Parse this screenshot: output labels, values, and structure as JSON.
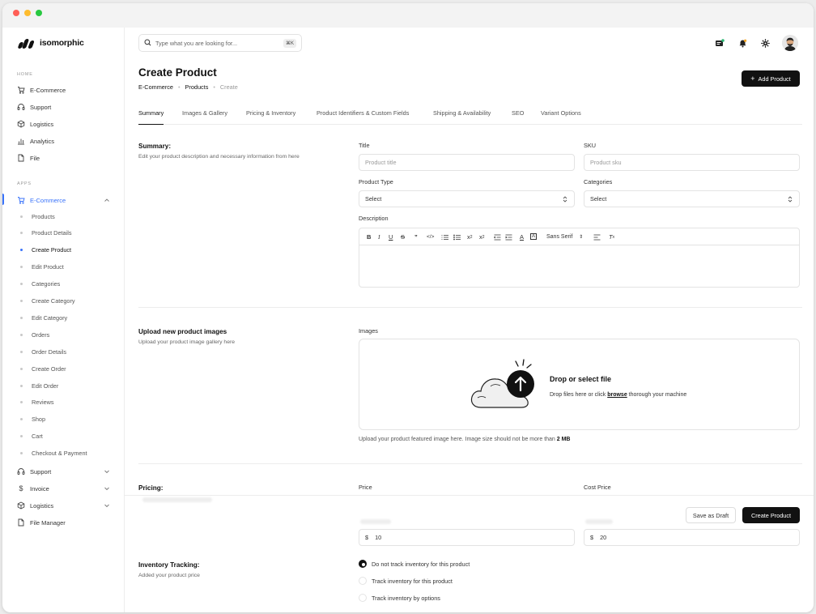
{
  "app": {
    "name": "isomorphic"
  },
  "sidebar": {
    "home_label": "HOME",
    "home_items": [
      {
        "label": "E-Commerce",
        "icon": "cart-icon"
      },
      {
        "label": "Support",
        "icon": "headset-icon"
      },
      {
        "label": "Logistics",
        "icon": "package-icon"
      },
      {
        "label": "Analytics",
        "icon": "chart-icon"
      },
      {
        "label": "File",
        "icon": "file-icon"
      }
    ],
    "apps_label": "APPS",
    "apps_active": {
      "label": "E-Commerce",
      "icon": "cart-icon"
    },
    "ecommerce_sub": [
      "Products",
      "Product Details",
      "Create Product",
      "Edit Product",
      "Categories",
      "Create Category",
      "Edit Category",
      "Orders",
      "Order Details",
      "Create Order",
      "Edit Order",
      "Reviews",
      "Shop",
      "Cart",
      "Checkout & Payment"
    ],
    "apps_items": [
      {
        "label": "Support",
        "icon": "headset-icon"
      },
      {
        "label": "Invoice",
        "icon": "dollar-icon"
      },
      {
        "label": "Logistics",
        "icon": "package-icon"
      },
      {
        "label": "File Manager",
        "icon": "file-icon"
      }
    ]
  },
  "topbar": {
    "search_placeholder": "Type what you are looking for...",
    "shortcut": "⌘K"
  },
  "page": {
    "title": "Create Product",
    "breadcrumb": [
      "E-Commerce",
      "Products",
      "Create"
    ],
    "add_button": "Add Product"
  },
  "tabs": [
    "Summary",
    "Images & Gallery",
    "Pricing & Inventory",
    "Product Identifiers & Custom Fields",
    "Shipping & Availability",
    "SEO",
    "Variant Options"
  ],
  "summary": {
    "title": "Summary:",
    "desc": "Edit your product description and necessary information from here",
    "title_label": "Title",
    "title_placeholder": "Product title",
    "sku_label": "SKU",
    "sku_placeholder": "Product sku",
    "type_label": "Product Type",
    "type_value": "Select",
    "categories_label": "Categories",
    "categories_value": "Select",
    "description_label": "Description",
    "font_select": "Sans Serif"
  },
  "images": {
    "title": "Upload new product images",
    "desc": "Upload your product image gallery here",
    "label": "Images",
    "drop_title": "Drop or select file",
    "drop_text_before": "Drop files here or click",
    "drop_link": "browse",
    "drop_text_after": "thorough your machine",
    "help_text": "Upload your product featured image here. Image size should not be more than",
    "help_size": "2 MB"
  },
  "pricing": {
    "title": "Pricing:",
    "price_label": "Price",
    "cost_label": "Cost Price",
    "currency": "$",
    "value1": "10",
    "value2": "20"
  },
  "inventory": {
    "title": "Inventory Tracking:",
    "desc": "Added your product price",
    "options": [
      "Do not track inventory for this product",
      "Track inventory for this product",
      "Track inventory by options"
    ],
    "selected": 0
  },
  "footer": {
    "draft_button": "Save as Draft",
    "create_button": "Create Product"
  }
}
